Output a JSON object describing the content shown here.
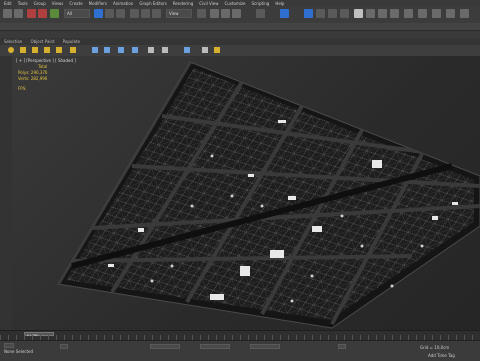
{
  "colors": {
    "menubar_bg": "#3a3a3a",
    "toolbar_bg": "#3c3c3c",
    "viewport_bg": "#2e2e2e",
    "stats_text": "#e0c040",
    "accent_blue": "#2f6fd0",
    "model_dark": "#1c1c1c",
    "model_grid": "#9a9a9a"
  },
  "menu": {
    "items": [
      "Edit",
      "Tools",
      "Group",
      "Views",
      "Create",
      "Modifiers",
      "Animation",
      "Graph Editors",
      "Rendering",
      "Civil View",
      "Customize",
      "Scripting",
      "Help"
    ]
  },
  "toolbar": {
    "filter_value": "All",
    "view_value": "View"
  },
  "subtabs": {
    "items": [
      "Selection",
      "Object Paint",
      "Populate"
    ]
  },
  "viewport": {
    "label": "[ + ] [Perspective ] [ Shaded ]",
    "stats": {
      "header": "Total",
      "polys_label": "Polys:",
      "polys_value": "290,376",
      "verts_label": "Verts:",
      "verts_value": "282,996",
      "fps_label": "FPS:"
    }
  },
  "timeline": {
    "frame_display": "0 / 100"
  },
  "status": {
    "text": "None Selected",
    "coords": "Grid = 10,0cm",
    "add_time_tag": "Add Time Tag"
  }
}
